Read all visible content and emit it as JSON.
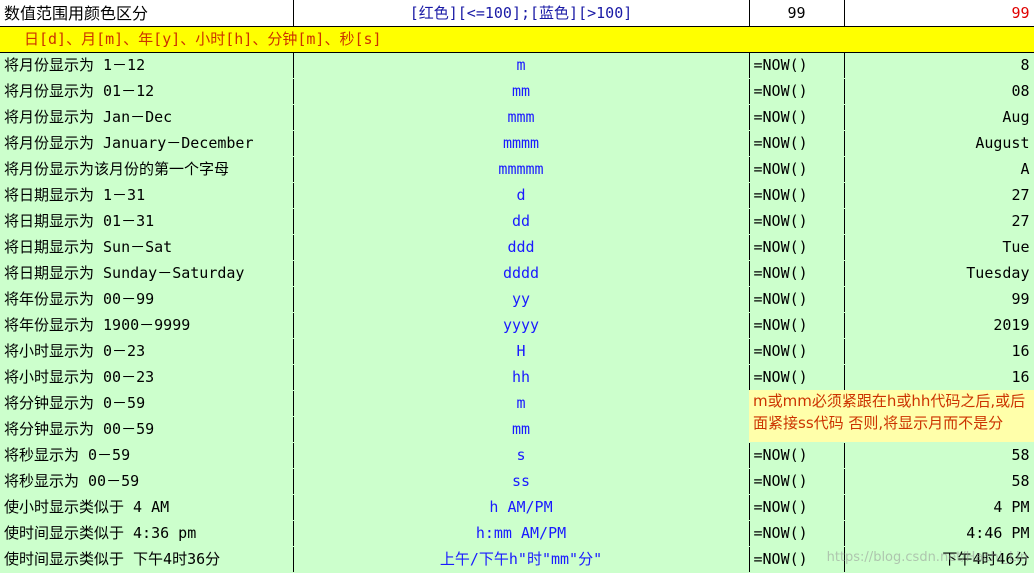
{
  "header": {
    "title": "数值范围用颜色区分",
    "format": "[红色][<=100];[蓝色][>100]",
    "value": "99",
    "result": "99"
  },
  "section": {
    "title": "日[d]、月[m]、年[y]、小时[h]、分钟[m]、秒[s]"
  },
  "rows": [
    {
      "label": "将月份显示为 1－12",
      "code": "m",
      "formula": "=NOW()",
      "result": "8"
    },
    {
      "label": "将月份显示为 01－12",
      "code": "mm",
      "formula": "=NOW()",
      "result": "08"
    },
    {
      "label": "将月份显示为 Jan－Dec",
      "code": "mmm",
      "formula": "=NOW()",
      "result": "Aug"
    },
    {
      "label": "将月份显示为 January－December",
      "code": "mmmm",
      "formula": "=NOW()",
      "result": "August"
    },
    {
      "label": "将月份显示为该月份的第一个字母",
      "code": "mmmmm",
      "formula": "=NOW()",
      "result": "A"
    },
    {
      "label": "将日期显示为 1－31",
      "code": "d",
      "formula": "=NOW()",
      "result": "27"
    },
    {
      "label": "将日期显示为 01－31",
      "code": "dd",
      "formula": "=NOW()",
      "result": "27"
    },
    {
      "label": "将日期显示为 Sun－Sat",
      "code": "ddd",
      "formula": "=NOW()",
      "result": "Tue"
    },
    {
      "label": "将日期显示为 Sunday－Saturday",
      "code": "dddd",
      "formula": "=NOW()",
      "result": "Tuesday"
    },
    {
      "label": "将年份显示为 00－99",
      "code": "yy",
      "formula": "=NOW()",
      "result": "99"
    },
    {
      "label": "将年份显示为 1900－9999",
      "code": "yyyy",
      "formula": "=NOW()",
      "result": "2019"
    },
    {
      "label": "将小时显示为 0－23",
      "code": "H",
      "formula": "=NOW()",
      "result": "16"
    },
    {
      "label": "将小时显示为 00－23",
      "code": "hh",
      "formula": "=NOW()",
      "result": "16"
    },
    {
      "label": "将分钟显示为 0－59",
      "code": "m",
      "formula": "",
      "result": ""
    },
    {
      "label": "将分钟显示为 00－59",
      "code": "mm",
      "formula": "",
      "result": ""
    },
    {
      "label": "将秒显示为 0－59",
      "code": "s",
      "formula": "=NOW()",
      "result": "58"
    },
    {
      "label": "将秒显示为 00－59",
      "code": "ss",
      "formula": "=NOW()",
      "result": "58"
    },
    {
      "label": "使小时显示类似于 4 AM",
      "code": "h AM/PM",
      "formula": "=NOW()",
      "result": "4 PM"
    },
    {
      "label": "使时间显示类似于 4:36 pm",
      "code": "h:mm AM/PM",
      "formula": "=NOW()",
      "result": "4:46 PM"
    },
    {
      "label": "使时间显示类似于 下午4时36分",
      "code": "上午/下午h\"时\"mm\"分\"",
      "formula": "=NOW()",
      "result": "下午4时46分"
    }
  ],
  "note": {
    "text": "m或mm必须紧跟在h或hh代码之后,或后面紧接ss代码 否则,将显示月而不是分"
  },
  "watermark": "https://blog.csdn.net/Hachi_Lin",
  "colors": {
    "sheet_bg": "#ccffcc",
    "section_bg": "#ffff00",
    "section_text": "#cc3300",
    "code_text": "#1a1aff",
    "note_bg": "#ffffaa",
    "negative_red": "#e00000"
  }
}
